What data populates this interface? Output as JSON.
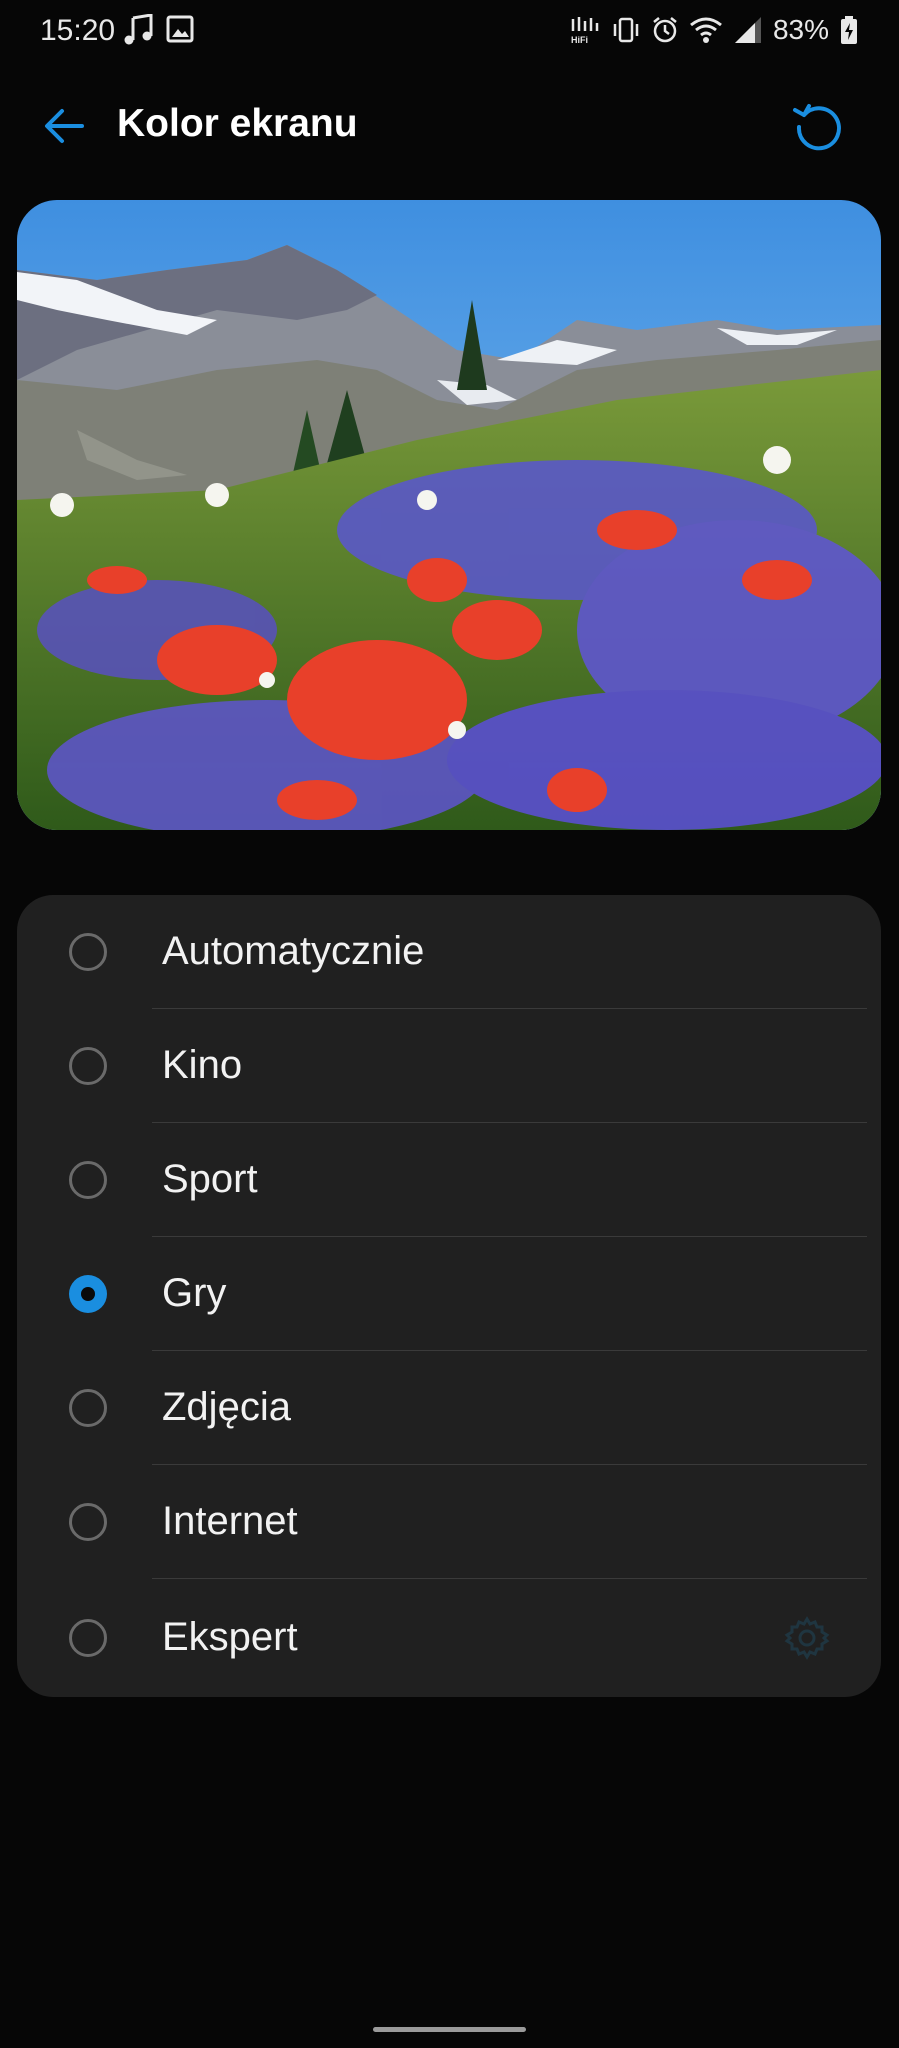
{
  "status_bar": {
    "time": "15:20",
    "battery": "83%",
    "left_icons": [
      "music-note-icon",
      "image-icon"
    ],
    "right_icons": [
      "hifi-icon",
      "vibrate-icon",
      "alarm-icon",
      "wifi-icon",
      "signal-icon",
      "battery-icon"
    ]
  },
  "header": {
    "title": "Kolor ekranu",
    "back_icon": "back-arrow-icon",
    "reset_icon": "reset-icon"
  },
  "colors": {
    "accent": "#1a8ee0",
    "background": "#060606",
    "card": "#202020"
  },
  "options": [
    {
      "label": "Automatycznie",
      "selected": false
    },
    {
      "label": "Kino",
      "selected": false
    },
    {
      "label": "Sport",
      "selected": false
    },
    {
      "label": "Gry",
      "selected": true
    },
    {
      "label": "Zdjęcia",
      "selected": false
    },
    {
      "label": "Internet",
      "selected": false
    },
    {
      "label": "Ekspert",
      "selected": false,
      "settings_icon": "gear-icon"
    }
  ]
}
